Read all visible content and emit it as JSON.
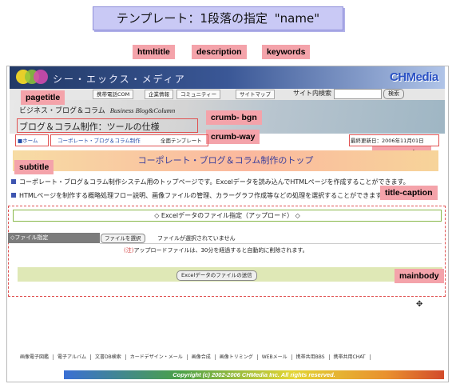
{
  "title": {
    "prefix": "テンプレート：1段落の指定",
    "name": "\"name\""
  },
  "labels": {
    "htmltitle": "htmltitle",
    "description": "description",
    "keywords": "keywords",
    "pagetitle": "pagetitle",
    "crumb_bgn": "crumb- bgn",
    "crumb_way": "crumb-way",
    "page_update": "page-update",
    "subtitle": "subtitle",
    "title_caption": "title-caption",
    "mainbody": "mainbody"
  },
  "header": {
    "site_name": "シー・エックス・メディア",
    "brand": "CHMedia",
    "nav": [
      "携帯電話COM",
      "企業情報",
      "コミュニティー",
      "サイトマップ"
    ],
    "search_label": "サイト内検索",
    "search_button": "検索"
  },
  "banner": {
    "category": "ビジネス・ブログ＆コラム",
    "category_en": "Business Blog&Column",
    "pagetitle": "ブログ＆コラム制作：ツールの仕様"
  },
  "crumbs": {
    "home": "■ホーム",
    "way": "コーポレート・ブログ＆コラム制作",
    "current": "全面テンプレート",
    "update": "最終更新日：2006年11月01日"
  },
  "subtitle": "コーポレート・ブログ＆コラム制作のトップ",
  "descriptions": [
    "コーポレート・ブログ＆コラム制作システム用のトップページです。Excelデータを読み込んでHTMLページを作成することができます。",
    "HTMLページを制作する概略処理フロー説明、画像ファイルの管理、カラーグラフ作成等などの処理を選択することができます。"
  ],
  "main": {
    "heading": "◇ Excelデータのファイル指定（アップロード） ◇",
    "file_label": "◇ファイル指定",
    "file_button": "ファイルを選択",
    "file_status": "ファイルが選択されていません",
    "note_mark": "(注)",
    "note": "アップロードファイルは、30分を経過すると自動的に削除されます。",
    "send_button": "Excelデータのファイルの送信"
  },
  "footer": {
    "links": [
      "画像電子図鑑",
      "電子アルバム",
      "文書DB検索",
      "カードデザイン・メール",
      "画像合成",
      "画像トリミング",
      "WEBメール",
      "携帯共用BBS",
      "携帯共用CHAT"
    ],
    "copyright": "Copyright (c) 2002-2006  CHMedia Inc.    All rights reserved."
  }
}
